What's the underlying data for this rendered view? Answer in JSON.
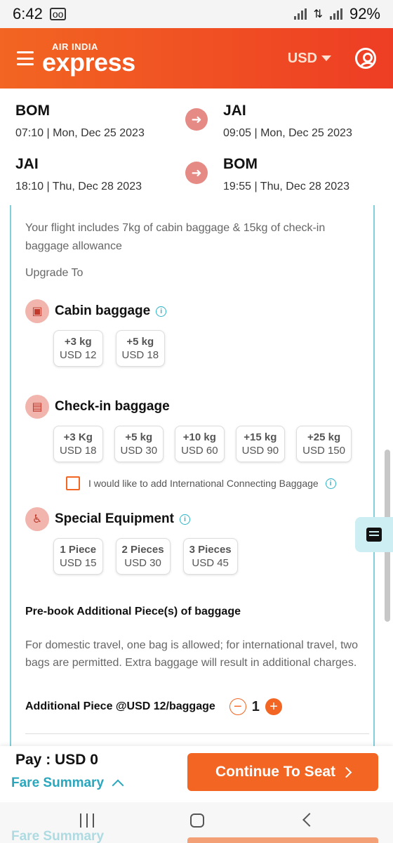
{
  "status_bar": {
    "time": "6:42",
    "notif_icon": "voicemail-icon",
    "battery": "92%"
  },
  "header": {
    "brand_small": "AIR INDIA",
    "brand_big": "express",
    "currency": "USD"
  },
  "itinerary": [
    {
      "from": "BOM",
      "from_dt": "07:10 | Mon, Dec 25 2023",
      "to": "JAI",
      "to_dt": "09:05 | Mon, Dec 25 2023"
    },
    {
      "from": "JAI",
      "from_dt": "18:10 | Thu, Dec 28 2023",
      "to": "BOM",
      "to_dt": "19:55 | Thu, Dec 28 2023"
    }
  ],
  "baggage": {
    "intro": "Your flight includes 7kg of cabin baggage & 15kg of check-in baggage allowance",
    "upgrade_label": "Upgrade To",
    "cabin": {
      "title": "Cabin baggage",
      "options": [
        {
          "weight": "+3 kg",
          "price": "USD 12"
        },
        {
          "weight": "+5 kg",
          "price": "USD 18"
        }
      ]
    },
    "checkin": {
      "title": "Check-in baggage",
      "options": [
        {
          "weight": "+3 Kg",
          "price": "USD 18"
        },
        {
          "weight": "+5 kg",
          "price": "USD 30"
        },
        {
          "weight": "+10 kg",
          "price": "USD 60"
        },
        {
          "weight": "+15 kg",
          "price": "USD 90"
        },
        {
          "weight": "+25 kg",
          "price": "USD 150"
        }
      ],
      "intl_checkbox_label": "I would like to add International Connecting Baggage"
    },
    "special": {
      "title": "Special Equipment",
      "options": [
        {
          "weight": "1 Piece",
          "price": "USD 15"
        },
        {
          "weight": "2 Pieces",
          "price": "USD 30"
        },
        {
          "weight": "3 Pieces",
          "price": "USD 45"
        }
      ]
    },
    "prebook": {
      "title": "Pre-book Additional Piece(s) of baggage",
      "text": "For domestic travel, one bag is allowed; for international travel, two bags are permitted. Extra baggage will result in additional charges.",
      "additional_label": "Additional Piece @USD 12/baggage",
      "quantity": "1"
    }
  },
  "footer": {
    "pay_label": "Pay : USD 0",
    "fare_summary": "Fare Summary",
    "continue": "Continue To Seat"
  }
}
